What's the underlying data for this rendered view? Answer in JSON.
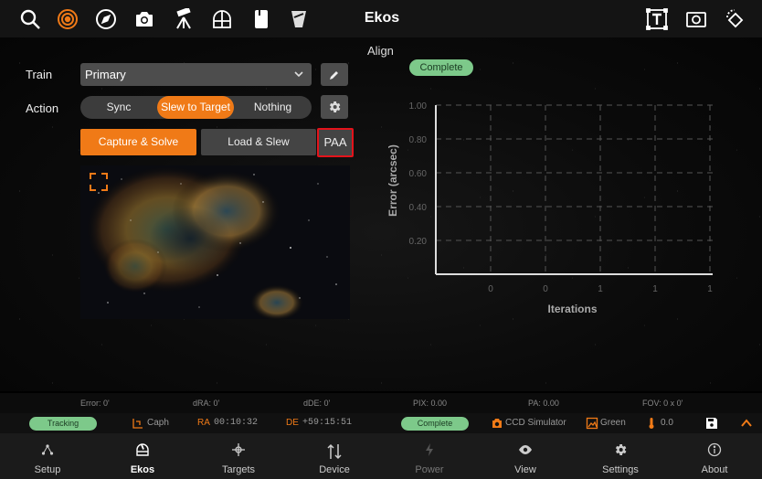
{
  "app": {
    "title": "Ekos"
  },
  "topbar": {
    "left_icons": [
      "search-icon",
      "target-icon",
      "compass-icon",
      "camera-icon",
      "telescope-icon",
      "observatory-icon",
      "scope-cover-icon",
      "focus-filter-icon"
    ],
    "right_icons": [
      "text-recognition-icon",
      "frame-icon",
      "rotate-icon"
    ]
  },
  "align": {
    "title": "Align",
    "status": "Complete",
    "train_label": "Train",
    "train_value": "Primary",
    "action_label": "Action",
    "actions": [
      "Sync",
      "Slew to Target",
      "Nothing"
    ],
    "active_action": "Slew to Target",
    "capture_button": "Capture & Solve",
    "load_button": "Load & Slew",
    "paa_button": "PAA"
  },
  "chart_data": {
    "type": "line",
    "xlabel": "Iterations",
    "ylabel": "Error (arcsec)",
    "x_ticks": [
      "0",
      "0",
      "1",
      "1",
      "1"
    ],
    "y_ticks": [
      "1.00",
      "0.80",
      "0.60",
      "0.40",
      "0.20"
    ],
    "ylim": [
      0,
      1
    ],
    "grid": true,
    "series": []
  },
  "infobar": {
    "error": "Error: 0'",
    "dra": "dRA: 0'",
    "dde": "dDE: 0'",
    "pix": "PIX: 0.00",
    "pa": "PA: 0.00",
    "fov": "FOV: 0 x 0'"
  },
  "statusbar": {
    "mount_status": "Tracking",
    "target_name": "Caph",
    "ra_label": "RA",
    "ra_value": "00:10:32",
    "de_label": "DE",
    "de_value": "+59:15:51",
    "capture_status": "Complete",
    "camera": "CCD Simulator",
    "filter": "Green",
    "temperature": "0.0",
    "colors": {
      "accent": "#f07a17",
      "status_green": "#7dc98a"
    }
  },
  "bottomnav": {
    "items": [
      {
        "label": "Setup",
        "icon": "setup-icon"
      },
      {
        "label": "Ekos",
        "icon": "ekos-icon"
      },
      {
        "label": "Targets",
        "icon": "targets-icon"
      },
      {
        "label": "Device",
        "icon": "device-icon"
      },
      {
        "label": "Power",
        "icon": "power-icon"
      },
      {
        "label": "View",
        "icon": "view-icon"
      },
      {
        "label": "Settings",
        "icon": "settings-icon"
      },
      {
        "label": "About",
        "icon": "about-icon"
      }
    ],
    "active": "Ekos"
  }
}
